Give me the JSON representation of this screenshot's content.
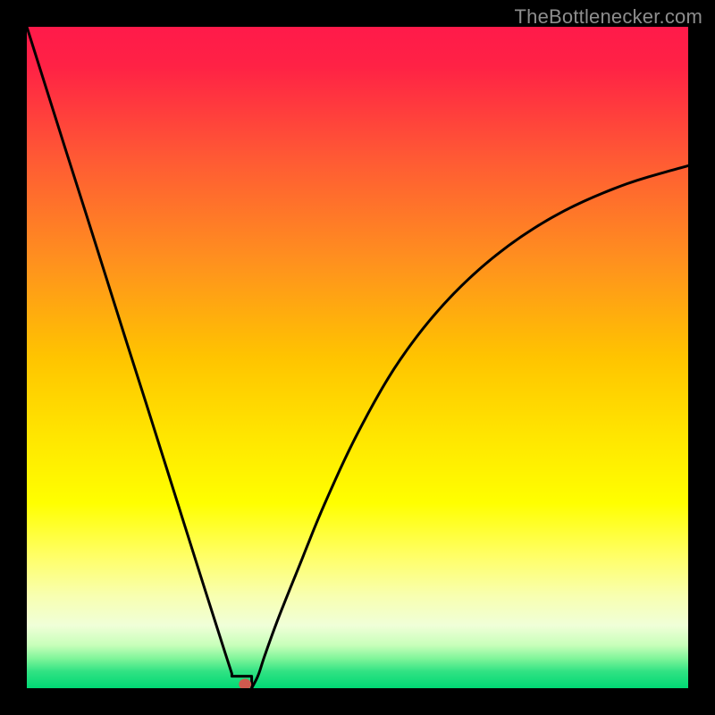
{
  "watermark": {
    "text": "TheBottlenecker.com"
  },
  "chart_data": {
    "type": "line",
    "title": "",
    "xlabel": "",
    "ylabel": "",
    "xlim": [
      0,
      1
    ],
    "ylim": [
      0,
      1
    ],
    "gradient_stops": [
      {
        "offset": 0.0,
        "color": "#ff1a4a"
      },
      {
        "offset": 0.06,
        "color": "#ff2245"
      },
      {
        "offset": 0.2,
        "color": "#ff5a34"
      },
      {
        "offset": 0.35,
        "color": "#ff8f1f"
      },
      {
        "offset": 0.5,
        "color": "#ffc400"
      },
      {
        "offset": 0.62,
        "color": "#ffe600"
      },
      {
        "offset": 0.72,
        "color": "#ffff00"
      },
      {
        "offset": 0.8,
        "color": "#ffff66"
      },
      {
        "offset": 0.86,
        "color": "#f8ffb0"
      },
      {
        "offset": 0.905,
        "color": "#f0ffd8"
      },
      {
        "offset": 0.935,
        "color": "#c8ffba"
      },
      {
        "offset": 0.955,
        "color": "#80f59a"
      },
      {
        "offset": 0.975,
        "color": "#30e283"
      },
      {
        "offset": 1.0,
        "color": "#00d874"
      }
    ],
    "series": [
      {
        "name": "bottleneck-curve",
        "x": [
          0.0,
          0.03,
          0.06,
          0.09,
          0.12,
          0.15,
          0.18,
          0.21,
          0.24,
          0.27,
          0.285,
          0.3,
          0.31,
          0.318,
          0.34,
          0.35,
          0.36,
          0.38,
          0.41,
          0.45,
          0.5,
          0.56,
          0.63,
          0.71,
          0.8,
          0.9,
          1.0
        ],
        "y": [
          1.0,
          0.905,
          0.81,
          0.716,
          0.621,
          0.526,
          0.432,
          0.337,
          0.242,
          0.147,
          0.1,
          0.053,
          0.022,
          0.0,
          0.0,
          0.02,
          0.05,
          0.105,
          0.18,
          0.278,
          0.385,
          0.49,
          0.58,
          0.655,
          0.715,
          0.76,
          0.79
        ]
      }
    ],
    "marker": {
      "x": 0.33,
      "y": 0.006,
      "color": "#cf5a4e",
      "rx": 7,
      "ry": 6
    },
    "notch": {
      "x0": 0.31,
      "x1": 0.34,
      "y": 0.018
    }
  }
}
